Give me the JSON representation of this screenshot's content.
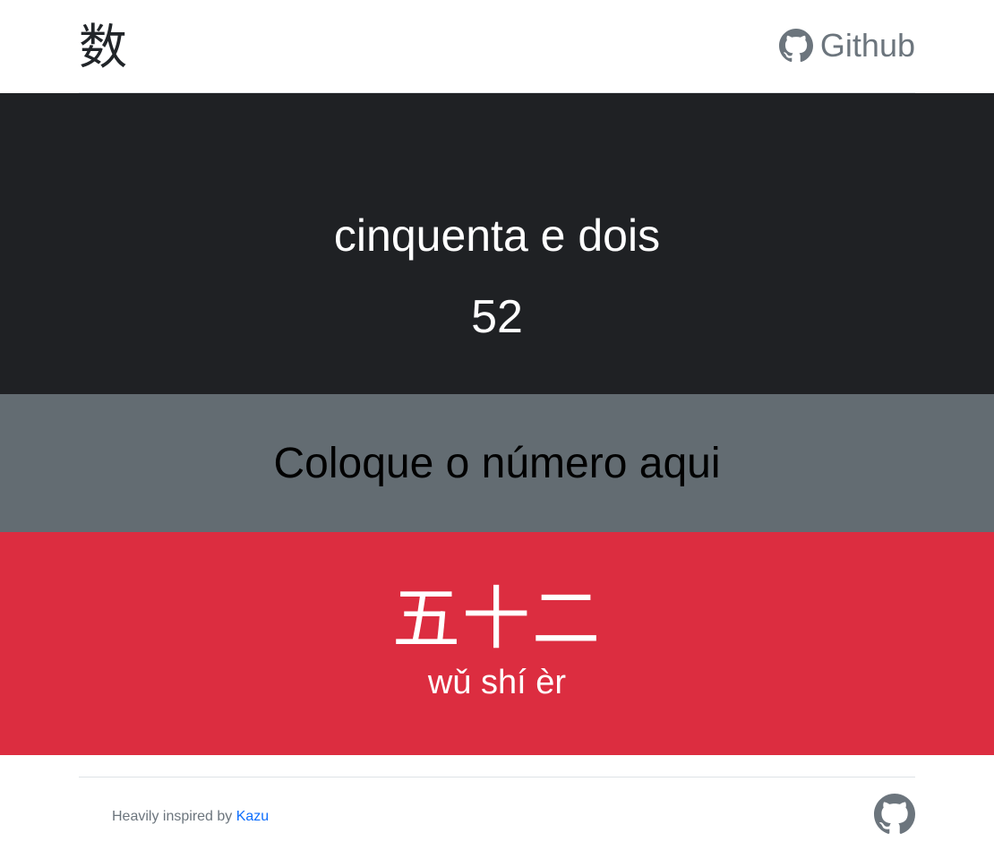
{
  "header": {
    "brand": "数",
    "github_label": "Github",
    "github_icon": "github-icon"
  },
  "display": {
    "words": "cinquenta e dois",
    "number": "52"
  },
  "input": {
    "placeholder": "Coloque o número aqui",
    "value": ""
  },
  "result": {
    "hanzi": "五十二",
    "pinyin": "wǔ shí èr"
  },
  "footer": {
    "text": "Heavily inspired by",
    "link_label": "Kazu",
    "github_icon": "github-icon"
  },
  "colors": {
    "dark_bg": "#1f2124",
    "input_bg": "#636c72",
    "red_bg": "#dc2d40",
    "link": "#0d6efd"
  }
}
